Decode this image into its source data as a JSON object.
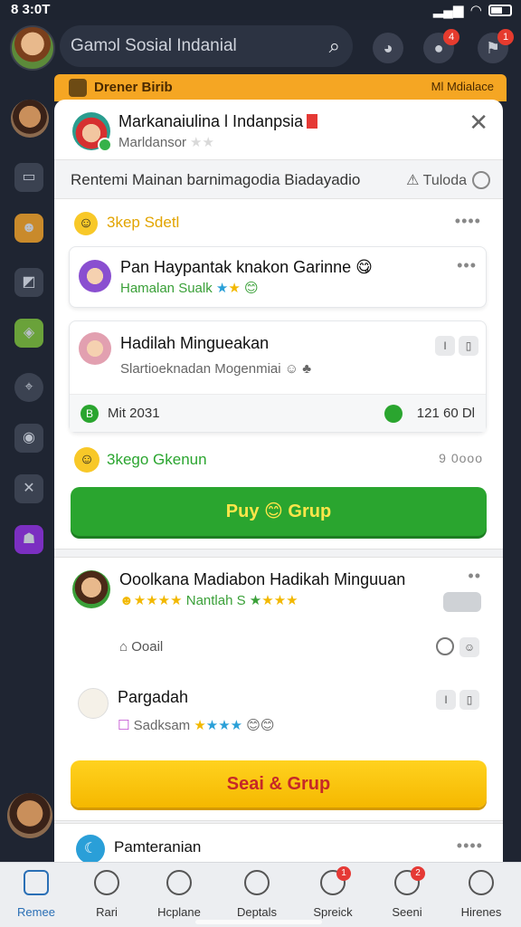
{
  "status_bar": {
    "time": "8 3:0T"
  },
  "top_bar": {
    "search_text": "Gamɔl Sosial Indanial",
    "badge_1": "4",
    "badge_2": "1"
  },
  "under_bar": {
    "left": "Drener Birib",
    "right": "Ml Mdialace"
  },
  "dialog": {
    "title": "Markanaiulina l Indanpsia",
    "subtitle": "Marldansor",
    "subtitle_stars": "★★",
    "tagline": "Rentemi Mainan barnimagodia Biadayadio",
    "tagline_right": "Tuloda",
    "sections": {
      "s1_label": "3kep Sdetl",
      "card1_title": "Pan Haypantak knakon Garinne",
      "card1_sub": "Hamalan Sualk",
      "card2_title": "Hadilah Mingueakan",
      "card2_sub": "Slartioeknadan Mogenmiai",
      "mix_left": "Mit 2031",
      "mix_right": "121 60 Dl",
      "s2_label": "3kego Gkenun",
      "s2_right": "9 0ooo",
      "green_button": "Puy 😊 Grup",
      "card3_title": "Ooolkana Madiabon Hadikah Minguuan",
      "card3_stars_text": "Nantlah S",
      "card3_bottom": "Ooail",
      "card4_title": "Pargadah",
      "card4_sub": "Sadksam",
      "yellow_button": "Seai & Grup",
      "bottom_item": "Pamteranian"
    }
  },
  "bottom_nav": [
    {
      "label": "Remee",
      "active": true
    },
    {
      "label": "Rari",
      "active": false
    },
    {
      "label": "Hcplane",
      "active": false
    },
    {
      "label": "Deptals",
      "active": false
    },
    {
      "label": "Spreick",
      "active": false,
      "badge": "1"
    },
    {
      "label": "Seeni",
      "active": false,
      "badge": "2"
    },
    {
      "label": "Hirenes",
      "active": false
    }
  ]
}
